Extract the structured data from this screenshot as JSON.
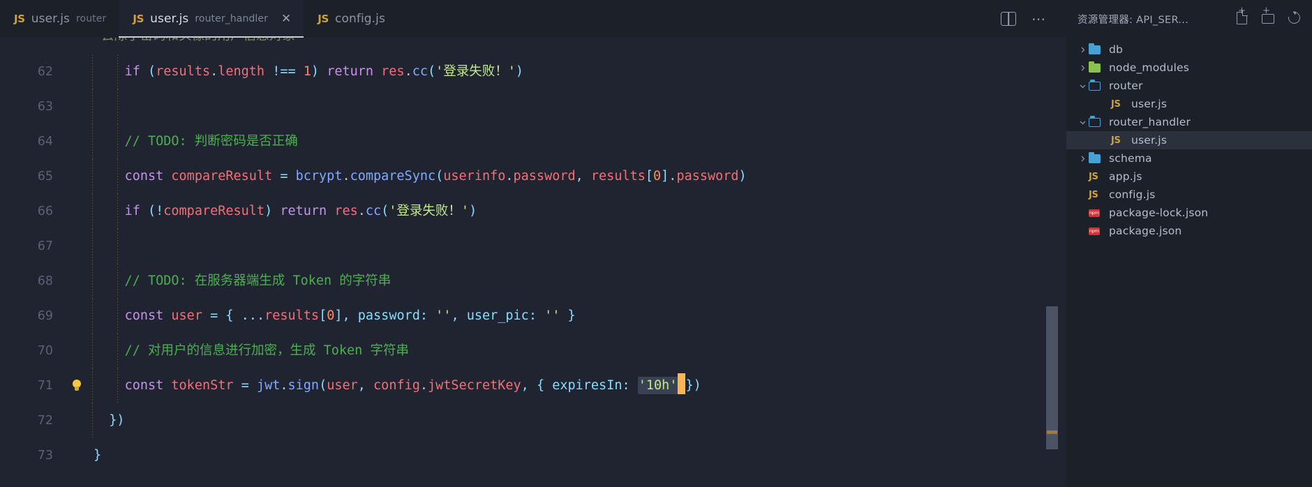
{
  "window": {
    "background": "#1f2430",
    "accent": "#c8cdd6"
  },
  "tabbar": {
    "tabs": [
      {
        "icon": "js-file-icon",
        "name": "user.js",
        "description": "router",
        "active": false,
        "closable": false
      },
      {
        "icon": "js-file-icon",
        "name": "user.js",
        "description": "router_handler",
        "active": true,
        "closable": true,
        "close_label": "✕"
      },
      {
        "icon": "js-file-icon",
        "name": "config.js",
        "description": "",
        "active": false,
        "closable": false
      }
    ],
    "actions": [
      {
        "name": "split-editor-icon"
      },
      {
        "name": "more-actions-icon",
        "label": "···"
      }
    ]
  },
  "editor": {
    "language": "javascript",
    "first_visible_line": 61,
    "partial_top_line": true,
    "lines": [
      {
        "number": 62,
        "tokens": [
          {
            "t": "    ",
            "c": "plain"
          },
          {
            "t": "if",
            "c": "kw"
          },
          {
            "t": " (",
            "c": "punc"
          },
          {
            "t": "results",
            "c": "var"
          },
          {
            "t": ".",
            "c": "plain"
          },
          {
            "t": "length",
            "c": "var"
          },
          {
            "t": " ",
            "c": "plain"
          },
          {
            "t": "!==",
            "c": "op"
          },
          {
            "t": " ",
            "c": "plain"
          },
          {
            "t": "1",
            "c": "num"
          },
          {
            "t": ") ",
            "c": "punc"
          },
          {
            "t": "return",
            "c": "kw"
          },
          {
            "t": " ",
            "c": "plain"
          },
          {
            "t": "res",
            "c": "var"
          },
          {
            "t": ".",
            "c": "plain"
          },
          {
            "t": "cc",
            "c": "method"
          },
          {
            "t": "(",
            "c": "punc"
          },
          {
            "t": "'登录失败！'",
            "c": "str"
          },
          {
            "t": ")",
            "c": "punc"
          }
        ]
      },
      {
        "number": 63,
        "tokens": []
      },
      {
        "number": 64,
        "tokens": [
          {
            "t": "    ",
            "c": "plain"
          },
          {
            "t": "// TODO: 判断密码是否正确",
            "c": "comment"
          }
        ]
      },
      {
        "number": 65,
        "tokens": [
          {
            "t": "    ",
            "c": "plain"
          },
          {
            "t": "const",
            "c": "kw"
          },
          {
            "t": " ",
            "c": "plain"
          },
          {
            "t": "compareResult",
            "c": "var"
          },
          {
            "t": " ",
            "c": "plain"
          },
          {
            "t": "=",
            "c": "op"
          },
          {
            "t": " ",
            "c": "plain"
          },
          {
            "t": "bcrypt",
            "c": "fn"
          },
          {
            "t": ".",
            "c": "plain"
          },
          {
            "t": "compareSync",
            "c": "method"
          },
          {
            "t": "(",
            "c": "punc"
          },
          {
            "t": "userinfo",
            "c": "var"
          },
          {
            "t": ".",
            "c": "plain"
          },
          {
            "t": "password",
            "c": "var"
          },
          {
            "t": ", ",
            "c": "punc"
          },
          {
            "t": "results",
            "c": "var"
          },
          {
            "t": "[",
            "c": "punc"
          },
          {
            "t": "0",
            "c": "num"
          },
          {
            "t": "]",
            "c": "punc"
          },
          {
            "t": ".",
            "c": "plain"
          },
          {
            "t": "password",
            "c": "var"
          },
          {
            "t": ")",
            "c": "punc"
          }
        ]
      },
      {
        "number": 66,
        "tokens": [
          {
            "t": "    ",
            "c": "plain"
          },
          {
            "t": "if",
            "c": "kw"
          },
          {
            "t": " (",
            "c": "punc"
          },
          {
            "t": "!",
            "c": "op"
          },
          {
            "t": "compareResult",
            "c": "var"
          },
          {
            "t": ") ",
            "c": "punc"
          },
          {
            "t": "return",
            "c": "kw"
          },
          {
            "t": " ",
            "c": "plain"
          },
          {
            "t": "res",
            "c": "var"
          },
          {
            "t": ".",
            "c": "plain"
          },
          {
            "t": "cc",
            "c": "method"
          },
          {
            "t": "(",
            "c": "punc"
          },
          {
            "t": "'登录失败！'",
            "c": "str"
          },
          {
            "t": ")",
            "c": "punc"
          }
        ]
      },
      {
        "number": 67,
        "tokens": []
      },
      {
        "number": 68,
        "tokens": [
          {
            "t": "    ",
            "c": "plain"
          },
          {
            "t": "// TODO: 在服务器端生成 Token 的字符串",
            "c": "comment"
          }
        ]
      },
      {
        "number": 69,
        "tokens": [
          {
            "t": "    ",
            "c": "plain"
          },
          {
            "t": "const",
            "c": "kw"
          },
          {
            "t": " ",
            "c": "plain"
          },
          {
            "t": "user",
            "c": "var"
          },
          {
            "t": " ",
            "c": "plain"
          },
          {
            "t": "=",
            "c": "op"
          },
          {
            "t": " { ",
            "c": "punc"
          },
          {
            "t": "...",
            "c": "op"
          },
          {
            "t": "results",
            "c": "var"
          },
          {
            "t": "[",
            "c": "punc"
          },
          {
            "t": "0",
            "c": "num"
          },
          {
            "t": "], ",
            "c": "punc"
          },
          {
            "t": "password",
            "c": "prop"
          },
          {
            "t": ": ",
            "c": "punc"
          },
          {
            "t": "''",
            "c": "str"
          },
          {
            "t": ", ",
            "c": "punc"
          },
          {
            "t": "user_pic",
            "c": "prop"
          },
          {
            "t": ": ",
            "c": "punc"
          },
          {
            "t": "''",
            "c": "str"
          },
          {
            "t": " }",
            "c": "punc"
          }
        ]
      },
      {
        "number": 70,
        "tokens": [
          {
            "t": "    ",
            "c": "plain"
          },
          {
            "t": "// 对用户的信息进行加密，生成 Token 字符串",
            "c": "comment"
          }
        ]
      },
      {
        "number": 71,
        "glyph": "lightbulb-icon",
        "cursor": true,
        "tokens": [
          {
            "t": "    ",
            "c": "plain"
          },
          {
            "t": "const",
            "c": "kw"
          },
          {
            "t": " ",
            "c": "plain"
          },
          {
            "t": "tokenStr",
            "c": "var"
          },
          {
            "t": " ",
            "c": "plain"
          },
          {
            "t": "=",
            "c": "op"
          },
          {
            "t": " ",
            "c": "plain"
          },
          {
            "t": "jwt",
            "c": "fn"
          },
          {
            "t": ".",
            "c": "plain"
          },
          {
            "t": "sign",
            "c": "method"
          },
          {
            "t": "(",
            "c": "punc"
          },
          {
            "t": "user",
            "c": "var"
          },
          {
            "t": ", ",
            "c": "punc"
          },
          {
            "t": "config",
            "c": "var"
          },
          {
            "t": ".",
            "c": "plain"
          },
          {
            "t": "jwtSecretKey",
            "c": "var"
          },
          {
            "t": ", { ",
            "c": "punc"
          },
          {
            "t": "expiresIn",
            "c": "prop"
          },
          {
            "t": ": ",
            "c": "punc"
          },
          {
            "t": "'10h'",
            "c": "str",
            "selected": true
          },
          {
            "t": "})",
            "c": "punc"
          }
        ]
      },
      {
        "number": 72,
        "tokens": [
          {
            "t": "  ",
            "c": "plain"
          },
          {
            "t": "})",
            "c": "punc"
          }
        ]
      },
      {
        "number": 73,
        "tokens": [
          {
            "t": "}",
            "c": "punc"
          }
        ]
      }
    ]
  },
  "sidebar": {
    "title": "资源管理器: API_SER...",
    "actions": [
      {
        "name": "new-file-icon"
      },
      {
        "name": "new-folder-icon"
      },
      {
        "name": "refresh-explorer-icon"
      }
    ],
    "tree": [
      {
        "label": "db",
        "type": "folder",
        "expanded": false,
        "indent": 1,
        "icon": "folder-icon"
      },
      {
        "label": "node_modules",
        "type": "folder",
        "expanded": false,
        "indent": 1,
        "icon": "folder-node-icon"
      },
      {
        "label": "router",
        "type": "folder",
        "expanded": true,
        "indent": 1,
        "icon": "folder-open-icon"
      },
      {
        "label": "user.js",
        "type": "js",
        "indent": 2,
        "icon": "js-file-icon"
      },
      {
        "label": "router_handler",
        "type": "folder",
        "expanded": true,
        "indent": 1,
        "icon": "folder-open-icon"
      },
      {
        "label": "user.js",
        "type": "js",
        "indent": 2,
        "icon": "js-file-icon",
        "selected": true
      },
      {
        "label": "schema",
        "type": "folder",
        "expanded": false,
        "indent": 1,
        "icon": "folder-icon"
      },
      {
        "label": "app.js",
        "type": "js",
        "indent": 1,
        "icon": "js-file-icon"
      },
      {
        "label": "config.js",
        "type": "js",
        "indent": 1,
        "icon": "js-file-icon"
      },
      {
        "label": "package-lock.json",
        "type": "json",
        "indent": 1,
        "icon": "npm-file-icon"
      },
      {
        "label": "package.json",
        "type": "json",
        "indent": 1,
        "icon": "npm-file-icon"
      }
    ]
  }
}
